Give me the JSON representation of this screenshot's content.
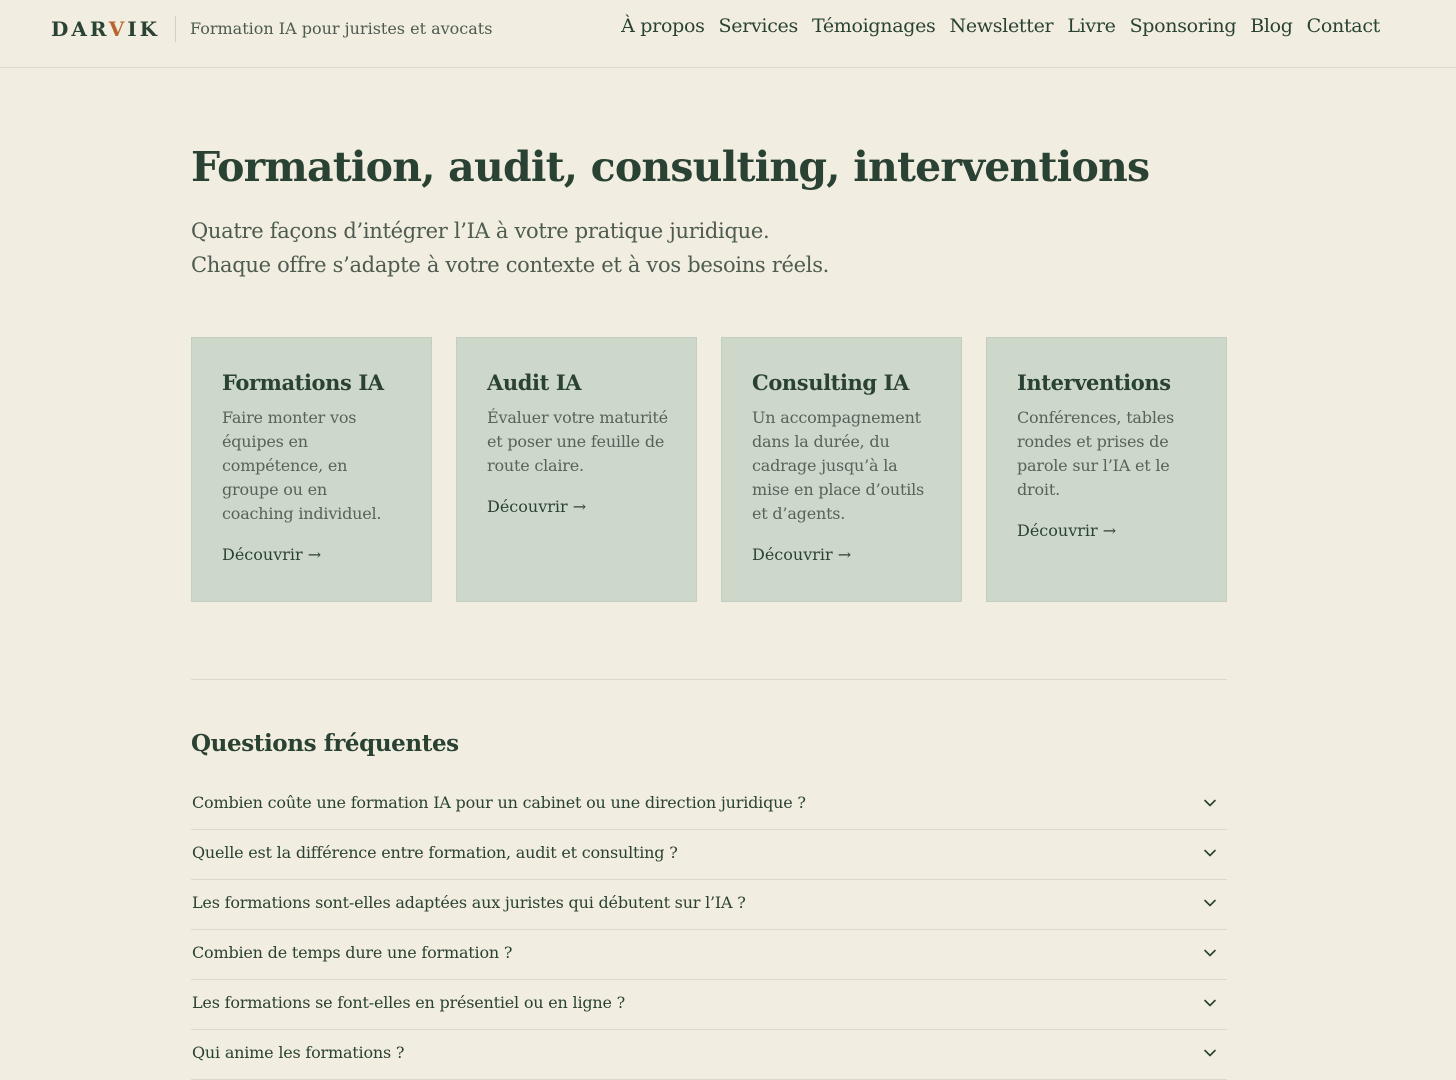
{
  "header": {
    "logo_part1": "DAR",
    "logo_accent": "V",
    "logo_part2": "IK",
    "tagline": "Formation IA pour juristes et avocats",
    "nav": [
      {
        "label": "À propos"
      },
      {
        "label": "Services"
      },
      {
        "label": "Témoignages"
      },
      {
        "label": "Newsletter"
      },
      {
        "label": "Livre"
      },
      {
        "label": "Sponsoring"
      },
      {
        "label": "Blog"
      },
      {
        "label": "Contact"
      }
    ]
  },
  "hero": {
    "title": "Formation, audit, consulting, interventions",
    "subtitle_line1": "Quatre façons d’intégrer l’IA à votre pratique juridique.",
    "subtitle_line2": "Chaque offre s’adapte à votre contexte et à vos besoins réels."
  },
  "cards": [
    {
      "title": "Formations IA",
      "description": "Faire monter vos équipes en compétence, en groupe ou en coaching individuel.",
      "link": "Découvrir →"
    },
    {
      "title": "Audit IA",
      "description": "Évaluer votre maturité et poser une feuille de route claire.",
      "link": "Découvrir →"
    },
    {
      "title": "Consulting IA",
      "description": "Un accompagnement dans la durée, du cadrage jusqu’à la mise en place d’outils et d’agents.",
      "link": "Découvrir →"
    },
    {
      "title": "Interventions",
      "description": "Conférences, tables rondes et prises de parole sur l’IA et le droit.",
      "link": "Découvrir →"
    }
  ],
  "faq": {
    "title": "Questions fréquentes",
    "items": [
      {
        "question": "Combien coûte une formation IA pour un cabinet ou une direction juridique ?"
      },
      {
        "question": "Quelle est la différence entre formation, audit et consulting ?"
      },
      {
        "question": "Les formations sont-elles adaptées aux juristes qui débutent sur l’IA ?"
      },
      {
        "question": "Combien de temps dure une formation ?"
      },
      {
        "question": "Les formations se font-elles en présentiel ou en ligne ?"
      },
      {
        "question": "Qui anime les formations ?"
      }
    ]
  },
  "colors": {
    "background": "#f1ede0",
    "text": "#2a4233",
    "card": "#cdd8cb",
    "logo_accent": "#b7652f"
  },
  "icons": {
    "faq_toggle": "chevron-down-icon"
  }
}
